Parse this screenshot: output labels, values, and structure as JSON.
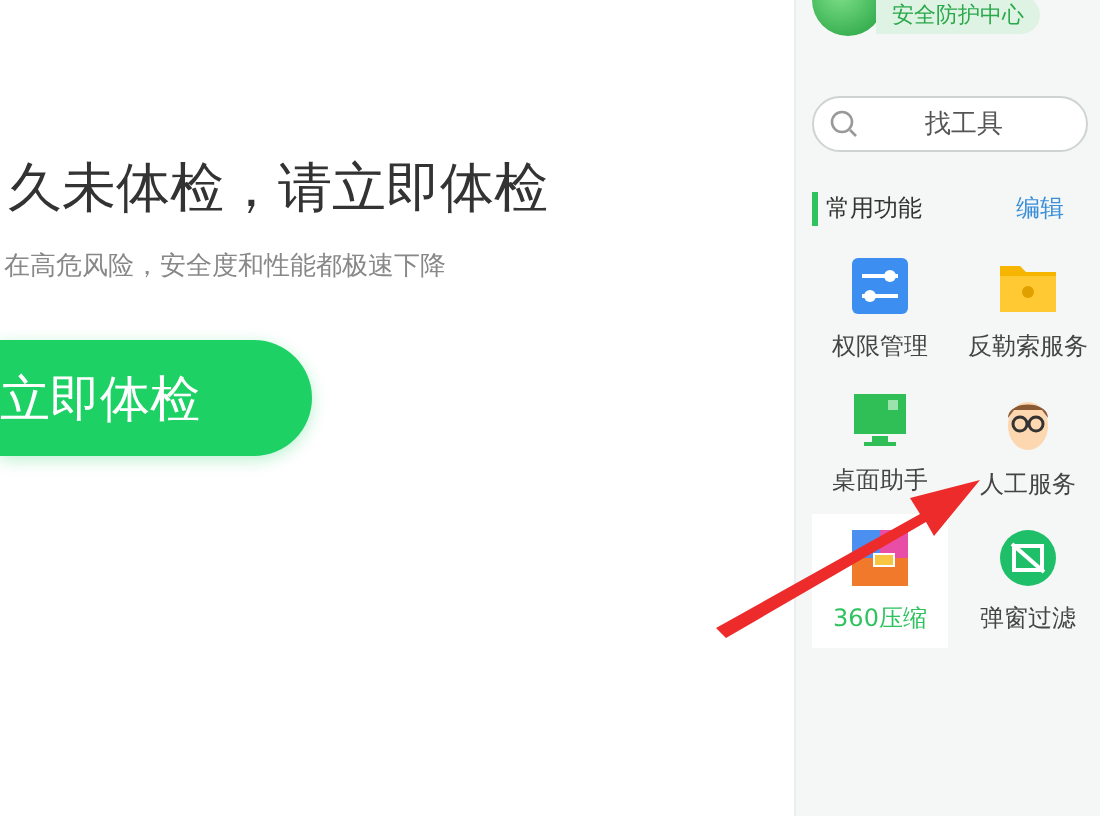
{
  "main": {
    "headline": "久未体检，请立即体检",
    "subtitle": "在高危风险，安全度和性能都极速下降",
    "scan_button": "立即体检"
  },
  "sidebar": {
    "center_label": "安全防护中心",
    "search": {
      "placeholder": "找工具"
    },
    "section_title": "常用功能",
    "edit_link": "编辑",
    "tools": [
      {
        "label": "权限管理",
        "kind": "sliders",
        "selected": false
      },
      {
        "label": "反勒索服务",
        "kind": "folder",
        "selected": false
      },
      {
        "label": "桌面助手",
        "kind": "monitor",
        "selected": false
      },
      {
        "label": "人工服务",
        "kind": "person",
        "selected": false
      },
      {
        "label": "360压缩",
        "kind": "archive",
        "selected": true
      },
      {
        "label": "弹窗过滤",
        "kind": "popup",
        "selected": false
      }
    ]
  },
  "annotation": {
    "kind": "arrow"
  }
}
